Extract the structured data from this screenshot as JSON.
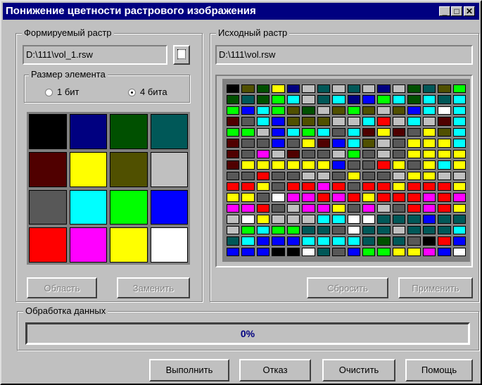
{
  "window": {
    "title": "Понижение цветности растрового изображения",
    "min": "_",
    "max": "□",
    "close": "✕"
  },
  "target": {
    "legend": "Формируемый растр",
    "path": "D:\\111\\vol_1.rsw"
  },
  "element_size": {
    "legend": "Размер элемента",
    "option1": "1 бит",
    "option2": "4 бита",
    "selected": "4 бита"
  },
  "palette": [
    "#000000",
    "#000080",
    "#005000",
    "#005858",
    "#500000",
    "#ffff00",
    "#505000",
    "#c0c0c0",
    "#585858",
    "#00ffff",
    "#00ff00",
    "#0000ff",
    "#ff0000",
    "#ff00ff",
    "#ffff00",
    "#ffffff"
  ],
  "source": {
    "legend": "Исходный растр",
    "path": "D:\\111\\vol.rsw"
  },
  "source_cells": [
    "0",
    "6",
    "2",
    "5",
    "1",
    "7",
    "3",
    "7",
    "3",
    "7",
    "1",
    "7",
    "2",
    "3",
    "6",
    "a",
    "2",
    "3",
    "2",
    "a",
    "9",
    "7",
    "3",
    "9",
    "1",
    "b",
    "a",
    "9",
    "2",
    "9",
    "3",
    "9",
    "a",
    "b",
    "9",
    "a",
    "6",
    "2",
    "7",
    "6",
    "a",
    "6",
    "7",
    "6",
    "b",
    "9",
    "f",
    "9",
    "4",
    "8",
    "9",
    "b",
    "6",
    "6",
    "6",
    "7",
    "7",
    "9",
    "c",
    "7",
    "9",
    "7",
    "4",
    "9",
    "a",
    "a",
    "7",
    "b",
    "9",
    "a",
    "9",
    "8",
    "9",
    "4",
    "5",
    "4",
    "8",
    "5",
    "6",
    "9",
    "4",
    "8",
    "8",
    "b",
    "8",
    "5",
    "4",
    "b",
    "9",
    "6",
    "7",
    "8",
    "5",
    "5",
    "5",
    "9",
    "4",
    "8",
    "d",
    "7",
    "4",
    "8",
    "8",
    "7",
    "a",
    "8",
    "7",
    "8",
    "5",
    "5",
    "5",
    "e",
    "4",
    "5",
    "5",
    "e",
    "5",
    "5",
    "e",
    "b",
    "8",
    "8",
    "c",
    "e",
    "8",
    "5",
    "9",
    "e",
    "8",
    "8",
    "c",
    "8",
    "8",
    "7",
    "7",
    "8",
    "e",
    "8",
    "8",
    "7",
    "e",
    "e",
    "7",
    "7",
    "c",
    "c",
    "e",
    "8",
    "c",
    "c",
    "d",
    "c",
    "8",
    "c",
    "c",
    "e",
    "c",
    "c",
    "c",
    "e",
    "e",
    "e",
    "8",
    "f",
    "d",
    "d",
    "c",
    "d",
    "c",
    "e",
    "c",
    "c",
    "c",
    "d",
    "c",
    "d",
    "d",
    "d",
    "c",
    "8",
    "7",
    "d",
    "d",
    "e",
    "8",
    "d",
    "7",
    "8",
    "c",
    "d",
    "c",
    "e",
    "7",
    "f",
    "e",
    "7",
    "7",
    "7",
    "9",
    "9",
    "f",
    "f",
    "3",
    "3",
    "3",
    "b",
    "3",
    "3",
    "7",
    "a",
    "9",
    "a",
    "a",
    "3",
    "3",
    "8",
    "f",
    "3",
    "3",
    "7",
    "3",
    "3",
    "3",
    "9",
    "3",
    "9",
    "b",
    "b",
    "b",
    "9",
    "9",
    "9",
    "9",
    "3",
    "2",
    "3",
    "8",
    "0",
    "c",
    "b",
    "b",
    "b",
    "b",
    "0",
    "0",
    "f",
    "3",
    "8",
    "b",
    "a",
    "a",
    "e",
    "e",
    "d",
    "b",
    "f"
  ],
  "buttons": {
    "region": "Область",
    "replace": "Заменить",
    "reset": "Сбросить",
    "apply": "Применить",
    "execute": "Выполнить",
    "cancel": "Отказ",
    "clear": "Очистить",
    "help": "Помощь"
  },
  "processing": {
    "legend": "Обработка данных",
    "progress": 0,
    "progress_label": "0%"
  },
  "colors": {
    "titlebar": "#000080",
    "face": "#c0c0c0"
  }
}
